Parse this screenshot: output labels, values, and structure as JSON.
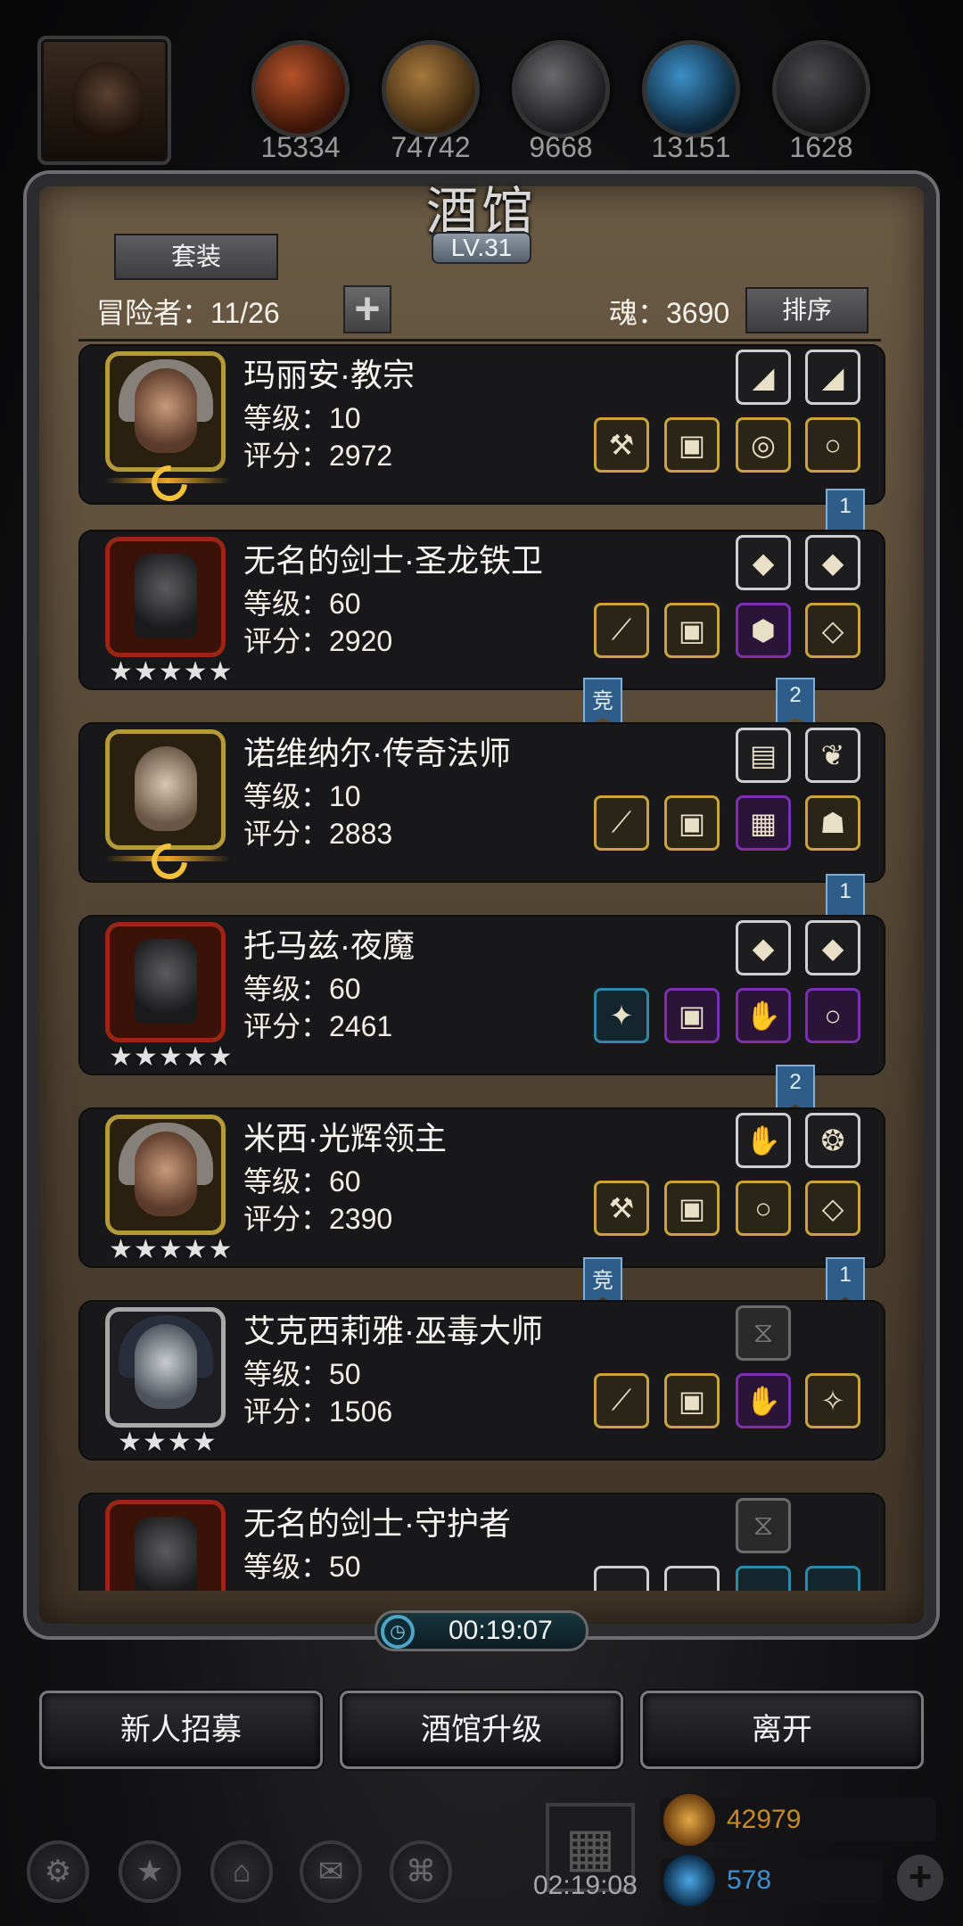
{
  "header": {
    "resources": [
      {
        "icon": "meat-icon",
        "value": "15334"
      },
      {
        "icon": "wood-icon",
        "value": "74742"
      },
      {
        "icon": "iron-icon",
        "value": "9668"
      },
      {
        "icon": "crystal-icon",
        "value": "13151"
      },
      {
        "icon": "ore-icon",
        "value": "1628"
      }
    ]
  },
  "panel": {
    "title": "酒馆",
    "level": "LV.31",
    "set_button": "套装",
    "adventurers_label": "冒险者：11/26",
    "soul_label": "魂：3690",
    "sort_button": "排序"
  },
  "heroes": [
    {
      "name": "玛丽安·教宗",
      "level": "等级：10",
      "score": "评分：2972",
      "frame": "gold",
      "stars": "",
      "moon": true
    },
    {
      "name": "无名的剑士·圣龙铁卫",
      "level": "等级：60",
      "score": "评分：2920",
      "frame": "red",
      "stars": "★★★★★",
      "moon": false
    },
    {
      "name": "诺维纳尔·传奇法师",
      "level": "等级：10",
      "score": "评分：2883",
      "frame": "gold",
      "stars": "",
      "moon": true
    },
    {
      "name": "托马兹·夜魔",
      "level": "等级：60",
      "score": "评分：2461",
      "frame": "red",
      "stars": "★★★★★",
      "moon": false
    },
    {
      "name": "米西·光辉领主",
      "level": "等级：60",
      "score": "评分：2390",
      "frame": "gold",
      "stars": "★★★★★",
      "moon": false
    },
    {
      "name": "艾克西莉雅·巫毒大师",
      "level": "等级：50",
      "score": "评分：1506",
      "frame": "silver",
      "stars": "★★★★",
      "moon": false
    },
    {
      "name": "无名的剑士·守护者",
      "level": "等级：50",
      "score": "",
      "frame": "red",
      "stars": "",
      "moon": false
    }
  ],
  "ribbons": {
    "r1": "1",
    "r2a": "竞",
    "r2b": "2",
    "r3": "1",
    "r4": "2",
    "r5a": "竞",
    "r5b": "1"
  },
  "timer": "00:19:07",
  "buttons": {
    "recruit": "新人招募",
    "upgrade": "酒馆升级",
    "leave": "离开"
  },
  "footer": {
    "gift_timer": "02:19:08",
    "gold": "42979",
    "gems": "578"
  },
  "colors": {
    "gold_frame": "#b59a3c",
    "red_frame": "#9c2515",
    "purple_slot": "#7a2fb5",
    "ribbon": "#2e5d8a"
  }
}
